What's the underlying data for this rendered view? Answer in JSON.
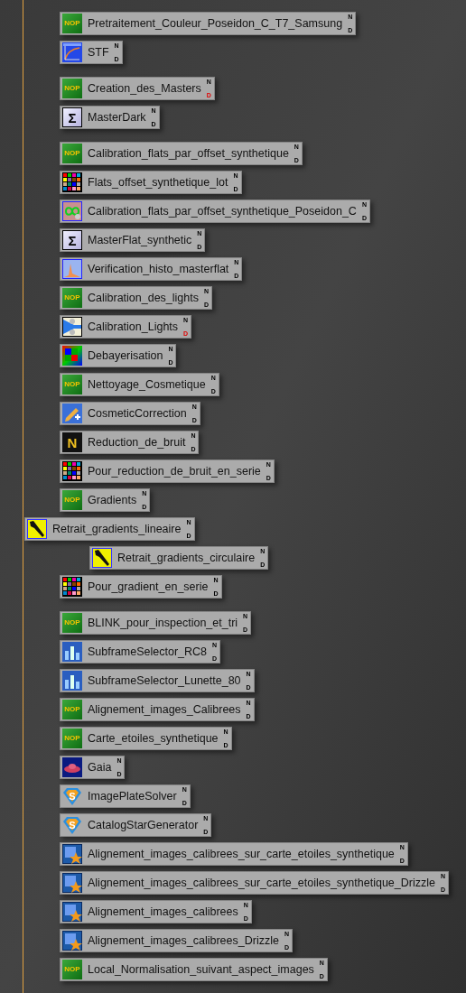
{
  "groups": [
    {
      "items": [
        {
          "label": "Pretraitement_Couleur_Poseidon_C_T7_Samsung",
          "kind": "nop",
          "badge": "NOP",
          "n": "N",
          "d": "D",
          "flagged": false
        },
        {
          "label": "STF",
          "kind": "stf",
          "n": "N",
          "d": "D",
          "flagged": false
        }
      ]
    },
    {
      "items": [
        {
          "label": "Creation_des_Masters",
          "kind": "nop",
          "badge": "NOP",
          "n": "N",
          "d": "D",
          "flagged": true
        },
        {
          "label": "MasterDark",
          "kind": "sigma",
          "badge": "Σ",
          "n": "N",
          "d": "D",
          "flagged": false
        }
      ]
    },
    {
      "items": [
        {
          "label": "Calibration_flats_par_offset_synthetique",
          "kind": "nop",
          "badge": "NOP",
          "n": "N",
          "d": "D",
          "flagged": false
        },
        {
          "label": "Flats_offset_synthetique_lot",
          "kind": "grid",
          "n": "N",
          "d": "D",
          "flagged": false
        },
        {
          "label": "Calibration_flats_par_offset_synthetique_Poseidon_C",
          "kind": "infinity",
          "n": "N",
          "d": "D",
          "flagged": false
        },
        {
          "label": "MasterFlat_synthetic",
          "kind": "sigma",
          "badge": "Σ",
          "n": "N",
          "d": "D",
          "flagged": false
        },
        {
          "label": "Verification_histo_masterflat",
          "kind": "histo",
          "n": "N",
          "d": "D",
          "flagged": false
        },
        {
          "label": "Calibration_des_lights",
          "kind": "nop",
          "badge": "NOP",
          "n": "N",
          "d": "D",
          "flagged": false
        },
        {
          "label": "Calibration_Lights",
          "kind": "calib",
          "n": "N",
          "d": "D",
          "flagged": true
        },
        {
          "label": "Debayerisation",
          "kind": "debayer",
          "n": "N",
          "d": "D",
          "flagged": false
        },
        {
          "label": "Nettoyage_Cosmetique",
          "kind": "nop",
          "badge": "NOP",
          "n": "N",
          "d": "D",
          "flagged": false
        },
        {
          "label": "CosmeticCorrection",
          "kind": "pencil",
          "n": "N",
          "d": "D",
          "flagged": false
        },
        {
          "label": "Reduction_de_bruit",
          "kind": "letter",
          "badge": "N",
          "n": "N",
          "d": "D",
          "flagged": false
        },
        {
          "label": "Pour_reduction_de_bruit_en_serie",
          "kind": "grid",
          "n": "N",
          "d": "D",
          "flagged": false
        },
        {
          "label": "Gradients",
          "kind": "nop",
          "badge": "NOP",
          "n": "N",
          "d": "D",
          "flagged": false
        },
        {
          "label": "Retrait_gradients_lineaire",
          "kind": "brush",
          "n": "N",
          "d": "D",
          "flagged": false
        },
        {
          "label": "Retrait_gradients_circulaire",
          "kind": "brush",
          "n": "N",
          "d": "D",
          "flagged": false
        },
        {
          "label": "Pour_gradient_en_serie",
          "kind": "grid",
          "n": "N",
          "d": "D",
          "flagged": false
        }
      ]
    },
    {
      "items": [
        {
          "label": "BLINK_pour_inspection_et_tri",
          "kind": "nop",
          "badge": "NOP",
          "n": "N",
          "d": "D",
          "flagged": false
        },
        {
          "label": "SubframeSelector_RC8",
          "kind": "bars",
          "n": "N",
          "d": "D",
          "flagged": false
        },
        {
          "label": "SubframeSelector_Lunette_80",
          "kind": "bars",
          "n": "N",
          "d": "D",
          "flagged": false
        },
        {
          "label": "Alignement_images_Calibrees",
          "kind": "nop",
          "badge": "NOP",
          "n": "N",
          "d": "D",
          "flagged": false
        },
        {
          "label": "Carte_etoiles_synthetique",
          "kind": "nop",
          "badge": "NOP",
          "n": "N",
          "d": "D",
          "flagged": false
        },
        {
          "label": "Gaia",
          "kind": "disc",
          "n": "N",
          "d": "D",
          "flagged": false
        },
        {
          "label": "ImagePlateSolver",
          "kind": "shield",
          "badge": "S",
          "n": "N",
          "d": "D",
          "flagged": false
        },
        {
          "label": "CatalogStarGenerator",
          "kind": "shield",
          "badge": "S",
          "n": "N",
          "d": "D",
          "flagged": false
        },
        {
          "label": "Alignement_images_calibrees_sur_carte_etoiles_synthetique",
          "kind": "star",
          "n": "N",
          "d": "D",
          "flagged": false
        },
        {
          "label": "Alignement_images_calibrees_sur_carte_etoiles_synthetique_Drizzle",
          "kind": "star",
          "n": "N",
          "d": "D",
          "flagged": false
        },
        {
          "label": "Alignement_images_calibrees",
          "kind": "star",
          "n": "N",
          "d": "D",
          "flagged": false
        },
        {
          "label": "Alignement_images_calibrees_Drizzle",
          "kind": "star",
          "n": "N",
          "d": "D",
          "flagged": false
        },
        {
          "label": "Local_Normalisation_suivant_aspect_images",
          "kind": "nop",
          "badge": "NOP",
          "n": "N",
          "d": "D",
          "flagged": false
        }
      ]
    }
  ]
}
